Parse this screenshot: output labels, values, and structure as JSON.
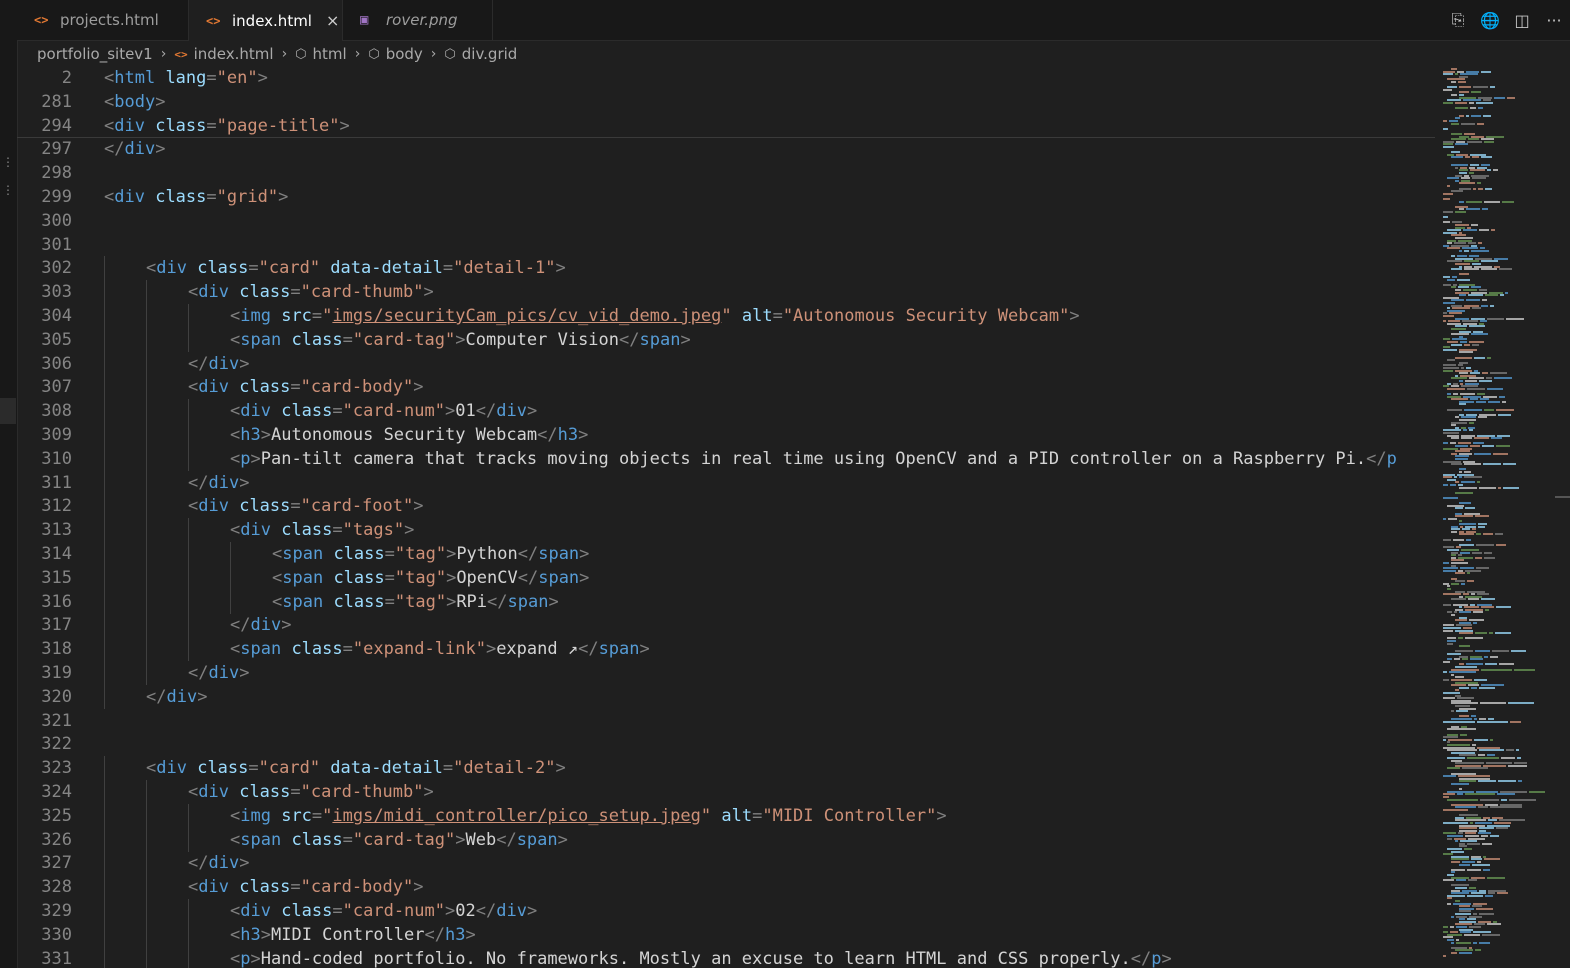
{
  "tabs": [
    {
      "label": "projects.html",
      "icon": "html-icon",
      "active": false,
      "italic": false
    },
    {
      "label": "index.html",
      "icon": "html-icon",
      "active": true,
      "italic": false,
      "close": "×"
    },
    {
      "label": "rover.png",
      "icon": "image-icon",
      "active": false,
      "italic": true
    }
  ],
  "tab_icons": {
    "html": "<>",
    "image": "▣"
  },
  "actions": [
    "open-changes-icon",
    "globe-icon",
    "split-editor-icon",
    "more-icon"
  ],
  "action_glyphs": [
    "⎘",
    "🌐",
    "◫",
    "···"
  ],
  "breadcrumb": [
    "portfolio_sitev1",
    "index.html",
    "html",
    "body",
    "div.grid"
  ],
  "breadcrumb_icons": {
    "file": "<>",
    "element": "⬡"
  },
  "sticky_lines": [
    {
      "num": "2",
      "indent": 0,
      "tokens": [
        [
          "p",
          "<"
        ],
        [
          "t",
          "html"
        ],
        [
          "at",
          " lang"
        ],
        [
          "p",
          "="
        ],
        [
          "s",
          "\"en\""
        ],
        [
          "p",
          ">"
        ]
      ]
    },
    {
      "num": "281",
      "indent": 0,
      "tokens": [
        [
          "p",
          "<"
        ],
        [
          "t",
          "body"
        ],
        [
          "p",
          ">"
        ]
      ]
    },
    {
      "num": "294",
      "indent": 0,
      "tokens": [
        [
          "p",
          "<"
        ],
        [
          "t",
          "div"
        ],
        [
          "at",
          " class"
        ],
        [
          "p",
          "="
        ],
        [
          "s",
          "\"page-title\""
        ],
        [
          "p",
          ">"
        ]
      ]
    }
  ],
  "lines": [
    {
      "num": "297",
      "indent": 0,
      "tokens": [
        [
          "p",
          "</"
        ],
        [
          "t",
          "div"
        ],
        [
          "p",
          ">"
        ]
      ]
    },
    {
      "num": "298",
      "indent": 0,
      "tokens": []
    },
    {
      "num": "299",
      "indent": 0,
      "tokens": [
        [
          "p",
          "<"
        ],
        [
          "t",
          "div"
        ],
        [
          "at",
          " class"
        ],
        [
          "p",
          "="
        ],
        [
          "s",
          "\"grid\""
        ],
        [
          "p",
          ">"
        ]
      ]
    },
    {
      "num": "300",
      "indent": 0,
      "tokens": []
    },
    {
      "num": "301",
      "indent": 0,
      "tokens": []
    },
    {
      "num": "302",
      "indent": 1,
      "tokens": [
        [
          "p",
          "<"
        ],
        [
          "t",
          "div"
        ],
        [
          "at",
          " class"
        ],
        [
          "p",
          "="
        ],
        [
          "s",
          "\"card\""
        ],
        [
          "at",
          " data-detail"
        ],
        [
          "p",
          "="
        ],
        [
          "s",
          "\"detail-1\""
        ],
        [
          "p",
          ">"
        ]
      ]
    },
    {
      "num": "303",
      "indent": 2,
      "tokens": [
        [
          "p",
          "<"
        ],
        [
          "t",
          "div"
        ],
        [
          "at",
          " class"
        ],
        [
          "p",
          "="
        ],
        [
          "s",
          "\"card-thumb\""
        ],
        [
          "p",
          ">"
        ]
      ]
    },
    {
      "num": "304",
      "indent": 3,
      "tokens": [
        [
          "p",
          "<"
        ],
        [
          "t",
          "img"
        ],
        [
          "at",
          " src"
        ],
        [
          "p",
          "="
        ],
        [
          "s",
          "\""
        ],
        [
          "su",
          "imgs/securityCam_pics/cv_vid_demo.jpeg"
        ],
        [
          "s",
          "\""
        ],
        [
          "at",
          " alt"
        ],
        [
          "p",
          "="
        ],
        [
          "s",
          "\"Autonomous Security Webcam\""
        ],
        [
          "p",
          ">"
        ]
      ]
    },
    {
      "num": "305",
      "indent": 3,
      "tokens": [
        [
          "p",
          "<"
        ],
        [
          "t",
          "span"
        ],
        [
          "at",
          " class"
        ],
        [
          "p",
          "="
        ],
        [
          "s",
          "\"card-tag\""
        ],
        [
          "p",
          ">"
        ],
        [
          "txt",
          "Computer Vision"
        ],
        [
          "p",
          "</"
        ],
        [
          "t",
          "span"
        ],
        [
          "p",
          ">"
        ]
      ]
    },
    {
      "num": "306",
      "indent": 2,
      "tokens": [
        [
          "p",
          "</"
        ],
        [
          "t",
          "div"
        ],
        [
          "p",
          ">"
        ]
      ]
    },
    {
      "num": "307",
      "indent": 2,
      "tokens": [
        [
          "p",
          "<"
        ],
        [
          "t",
          "div"
        ],
        [
          "at",
          " class"
        ],
        [
          "p",
          "="
        ],
        [
          "s",
          "\"card-body\""
        ],
        [
          "p",
          ">"
        ]
      ]
    },
    {
      "num": "308",
      "indent": 3,
      "tokens": [
        [
          "p",
          "<"
        ],
        [
          "t",
          "div"
        ],
        [
          "at",
          " class"
        ],
        [
          "p",
          "="
        ],
        [
          "s",
          "\"card-num\""
        ],
        [
          "p",
          ">"
        ],
        [
          "txt",
          "01"
        ],
        [
          "p",
          "</"
        ],
        [
          "t",
          "div"
        ],
        [
          "p",
          ">"
        ]
      ]
    },
    {
      "num": "309",
      "indent": 3,
      "tokens": [
        [
          "p",
          "<"
        ],
        [
          "t",
          "h3"
        ],
        [
          "p",
          ">"
        ],
        [
          "txt",
          "Autonomous Security Webcam"
        ],
        [
          "p",
          "</"
        ],
        [
          "t",
          "h3"
        ],
        [
          "p",
          ">"
        ]
      ]
    },
    {
      "num": "310",
      "indent": 3,
      "tokens": [
        [
          "p",
          "<"
        ],
        [
          "t",
          "p"
        ],
        [
          "p",
          ">"
        ],
        [
          "txt",
          "Pan-tilt camera that tracks moving objects in real time using OpenCV and a PID controller on a Raspberry Pi."
        ],
        [
          "p",
          "</"
        ],
        [
          "t",
          "p"
        ]
      ]
    },
    {
      "num": "311",
      "indent": 2,
      "tokens": [
        [
          "p",
          "</"
        ],
        [
          "t",
          "div"
        ],
        [
          "p",
          ">"
        ]
      ]
    },
    {
      "num": "312",
      "indent": 2,
      "tokens": [
        [
          "p",
          "<"
        ],
        [
          "t",
          "div"
        ],
        [
          "at",
          " class"
        ],
        [
          "p",
          "="
        ],
        [
          "s",
          "\"card-foot\""
        ],
        [
          "p",
          ">"
        ]
      ]
    },
    {
      "num": "313",
      "indent": 3,
      "tokens": [
        [
          "p",
          "<"
        ],
        [
          "t",
          "div"
        ],
        [
          "at",
          " class"
        ],
        [
          "p",
          "="
        ],
        [
          "s",
          "\"tags\""
        ],
        [
          "p",
          ">"
        ]
      ]
    },
    {
      "num": "314",
      "indent": 4,
      "tokens": [
        [
          "p",
          "<"
        ],
        [
          "t",
          "span"
        ],
        [
          "at",
          " class"
        ],
        [
          "p",
          "="
        ],
        [
          "s",
          "\"tag\""
        ],
        [
          "p",
          ">"
        ],
        [
          "txt",
          "Python"
        ],
        [
          "p",
          "</"
        ],
        [
          "t",
          "span"
        ],
        [
          "p",
          ">"
        ]
      ]
    },
    {
      "num": "315",
      "indent": 4,
      "tokens": [
        [
          "p",
          "<"
        ],
        [
          "t",
          "span"
        ],
        [
          "at",
          " class"
        ],
        [
          "p",
          "="
        ],
        [
          "s",
          "\"tag\""
        ],
        [
          "p",
          ">"
        ],
        [
          "txt",
          "OpenCV"
        ],
        [
          "p",
          "</"
        ],
        [
          "t",
          "span"
        ],
        [
          "p",
          ">"
        ]
      ]
    },
    {
      "num": "316",
      "indent": 4,
      "tokens": [
        [
          "p",
          "<"
        ],
        [
          "t",
          "span"
        ],
        [
          "at",
          " class"
        ],
        [
          "p",
          "="
        ],
        [
          "s",
          "\"tag\""
        ],
        [
          "p",
          ">"
        ],
        [
          "txt",
          "RPi"
        ],
        [
          "p",
          "</"
        ],
        [
          "t",
          "span"
        ],
        [
          "p",
          ">"
        ]
      ]
    },
    {
      "num": "317",
      "indent": 3,
      "tokens": [
        [
          "p",
          "</"
        ],
        [
          "t",
          "div"
        ],
        [
          "p",
          ">"
        ]
      ]
    },
    {
      "num": "318",
      "indent": 3,
      "tokens": [
        [
          "p",
          "<"
        ],
        [
          "t",
          "span"
        ],
        [
          "at",
          " class"
        ],
        [
          "p",
          "="
        ],
        [
          "s",
          "\"expand-link\""
        ],
        [
          "p",
          ">"
        ],
        [
          "txt",
          "expand ↗"
        ],
        [
          "p",
          "</"
        ],
        [
          "t",
          "span"
        ],
        [
          "p",
          ">"
        ]
      ]
    },
    {
      "num": "319",
      "indent": 2,
      "tokens": [
        [
          "p",
          "</"
        ],
        [
          "t",
          "div"
        ],
        [
          "p",
          ">"
        ]
      ]
    },
    {
      "num": "320",
      "indent": 1,
      "tokens": [
        [
          "p",
          "</"
        ],
        [
          "t",
          "div"
        ],
        [
          "p",
          ">"
        ]
      ]
    },
    {
      "num": "321",
      "indent": 0,
      "tokens": []
    },
    {
      "num": "322",
      "indent": 0,
      "tokens": []
    },
    {
      "num": "323",
      "indent": 1,
      "tokens": [
        [
          "p",
          "<"
        ],
        [
          "t",
          "div"
        ],
        [
          "at",
          " class"
        ],
        [
          "p",
          "="
        ],
        [
          "s",
          "\"card\""
        ],
        [
          "at",
          " data-detail"
        ],
        [
          "p",
          "="
        ],
        [
          "s",
          "\"detail-2\""
        ],
        [
          "p",
          ">"
        ]
      ]
    },
    {
      "num": "324",
      "indent": 2,
      "tokens": [
        [
          "p",
          "<"
        ],
        [
          "t",
          "div"
        ],
        [
          "at",
          " class"
        ],
        [
          "p",
          "="
        ],
        [
          "s",
          "\"card-thumb\""
        ],
        [
          "p",
          ">"
        ]
      ]
    },
    {
      "num": "325",
      "indent": 3,
      "tokens": [
        [
          "p",
          "<"
        ],
        [
          "t",
          "img"
        ],
        [
          "at",
          " src"
        ],
        [
          "p",
          "="
        ],
        [
          "s",
          "\""
        ],
        [
          "su",
          "imgs/midi_controller/pico_setup.jpeg"
        ],
        [
          "s",
          "\""
        ],
        [
          "at",
          " alt"
        ],
        [
          "p",
          "="
        ],
        [
          "s",
          "\"MIDI Controller\""
        ],
        [
          "p",
          ">"
        ]
      ]
    },
    {
      "num": "326",
      "indent": 3,
      "tokens": [
        [
          "p",
          "<"
        ],
        [
          "t",
          "span"
        ],
        [
          "at",
          " class"
        ],
        [
          "p",
          "="
        ],
        [
          "s",
          "\"card-tag\""
        ],
        [
          "p",
          ">"
        ],
        [
          "txt",
          "Web"
        ],
        [
          "p",
          "</"
        ],
        [
          "t",
          "span"
        ],
        [
          "p",
          ">"
        ]
      ]
    },
    {
      "num": "327",
      "indent": 2,
      "tokens": [
        [
          "p",
          "</"
        ],
        [
          "t",
          "div"
        ],
        [
          "p",
          ">"
        ]
      ]
    },
    {
      "num": "328",
      "indent": 2,
      "tokens": [
        [
          "p",
          "<"
        ],
        [
          "t",
          "div"
        ],
        [
          "at",
          " class"
        ],
        [
          "p",
          "="
        ],
        [
          "s",
          "\"card-body\""
        ],
        [
          "p",
          ">"
        ]
      ]
    },
    {
      "num": "329",
      "indent": 3,
      "tokens": [
        [
          "p",
          "<"
        ],
        [
          "t",
          "div"
        ],
        [
          "at",
          " class"
        ],
        [
          "p",
          "="
        ],
        [
          "s",
          "\"card-num\""
        ],
        [
          "p",
          ">"
        ],
        [
          "txt",
          "02"
        ],
        [
          "p",
          "</"
        ],
        [
          "t",
          "div"
        ],
        [
          "p",
          ">"
        ]
      ]
    },
    {
      "num": "330",
      "indent": 3,
      "tokens": [
        [
          "p",
          "<"
        ],
        [
          "t",
          "h3"
        ],
        [
          "p",
          ">"
        ],
        [
          "txt",
          "MIDI Controller"
        ],
        [
          "p",
          "</"
        ],
        [
          "t",
          "h3"
        ],
        [
          "p",
          ">"
        ]
      ]
    },
    {
      "num": "331",
      "indent": 3,
      "tokens": [
        [
          "p",
          "<"
        ],
        [
          "t",
          "p"
        ],
        [
          "p",
          ">"
        ],
        [
          "txt",
          "Hand-coded portfolio. No frameworks. Mostly an excuse to learn HTML and CSS properly."
        ],
        [
          "p",
          "</"
        ],
        [
          "t",
          "p"
        ],
        [
          "p",
          ">"
        ]
      ]
    }
  ],
  "colors": {
    "tag": "#569cd6",
    "punct": "#808080",
    "attr": "#9cdcfe",
    "string": "#ce9178",
    "text": "#d4d4d4",
    "linenum": "#858585",
    "html_icon": "#e37933",
    "image_icon": "#a074c4"
  }
}
